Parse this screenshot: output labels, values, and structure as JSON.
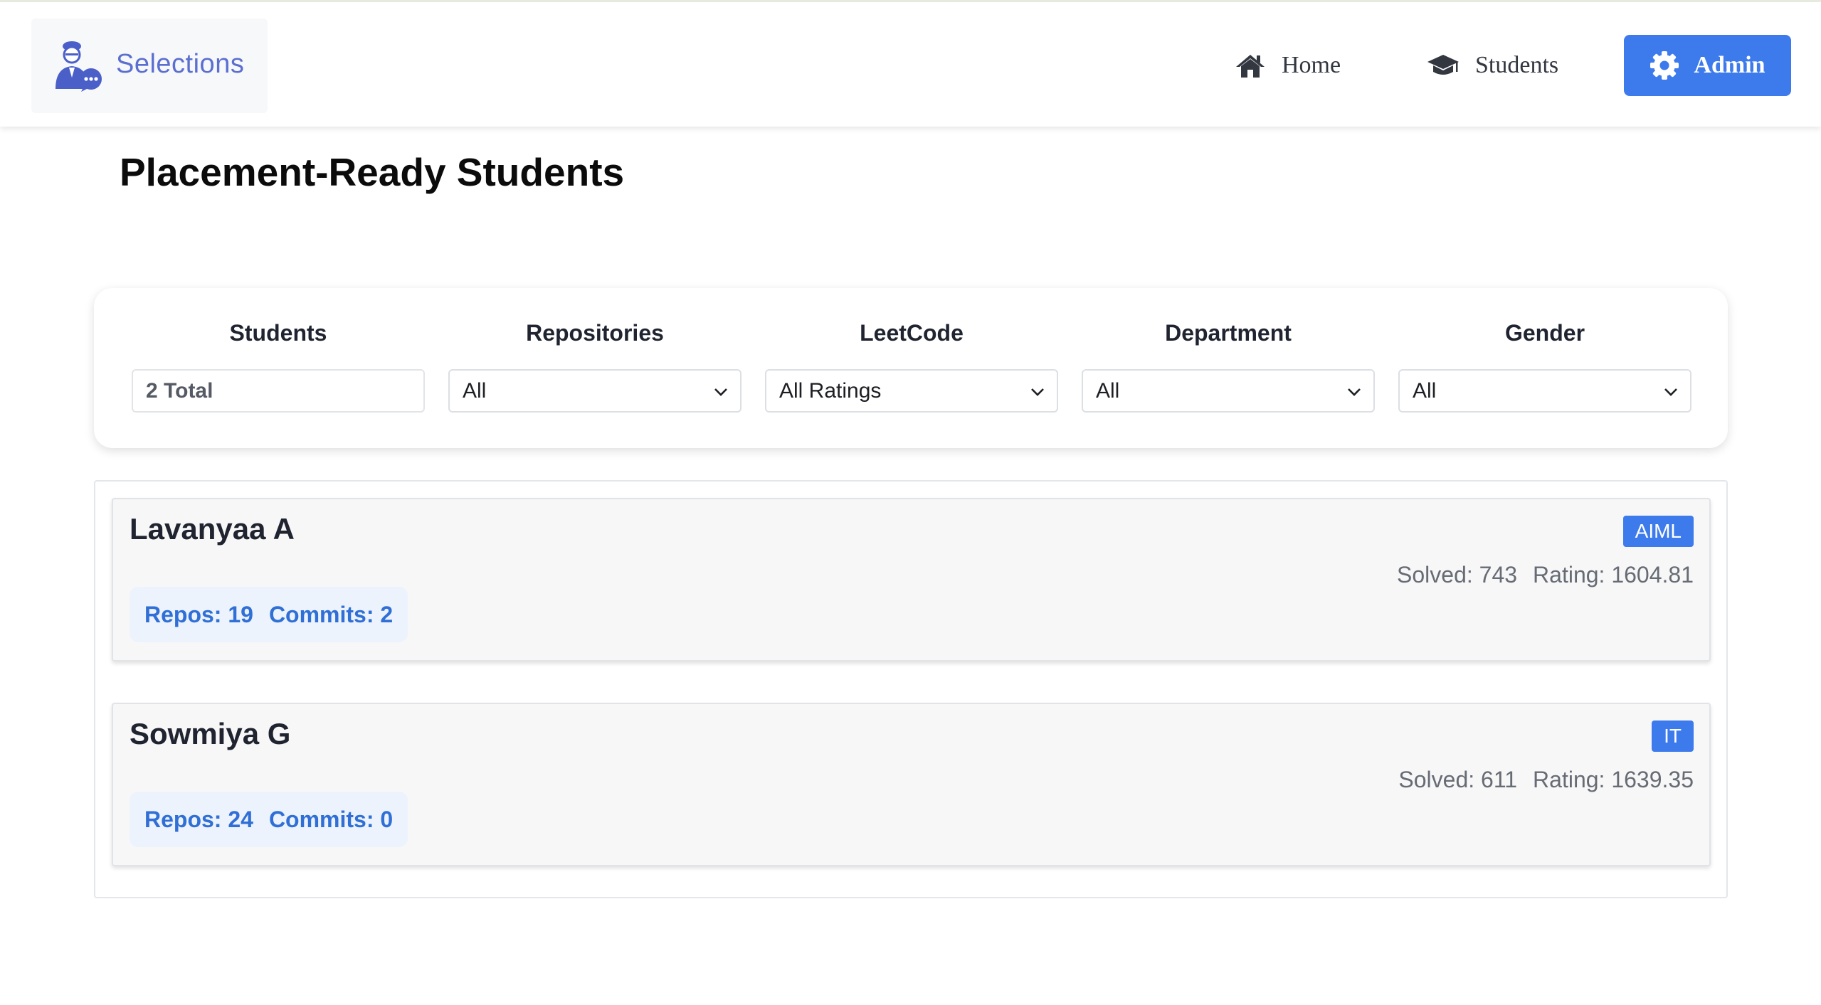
{
  "navbar": {
    "brand": "Selections",
    "links": {
      "home": "Home",
      "students": "Students",
      "admin": "Admin"
    },
    "icons": {
      "brand": "user-chat-icon",
      "home": "home-icon",
      "students": "graduation-cap-icon",
      "admin": "gear-icon"
    }
  },
  "page": {
    "title": "Placement-Ready Students"
  },
  "filters": {
    "students": {
      "label": "Students",
      "value": "2 Total"
    },
    "repositories": {
      "label": "Repositories",
      "value": "All"
    },
    "leetcode": {
      "label": "LeetCode",
      "value": "All Ratings"
    },
    "department": {
      "label": "Department",
      "value": "All"
    },
    "gender": {
      "label": "Gender",
      "value": "All"
    }
  },
  "students": [
    {
      "name": "Lavanyaa A",
      "department": "AIML",
      "solved": "Solved: 743",
      "rating": "Rating: 1604.81",
      "repos": "Repos: 19",
      "commits": "Commits: 2"
    },
    {
      "name": "Sowmiya G",
      "department": "IT",
      "solved": "Solved: 611",
      "rating": "Rating: 1639.35",
      "repos": "Repos: 24",
      "commits": "Commits: 0"
    }
  ],
  "colors": {
    "accent": "#3d7bec",
    "brand_text": "#5b6fd0",
    "repo_text": "#2f6fd6",
    "repo_bg": "#edf3fc"
  }
}
